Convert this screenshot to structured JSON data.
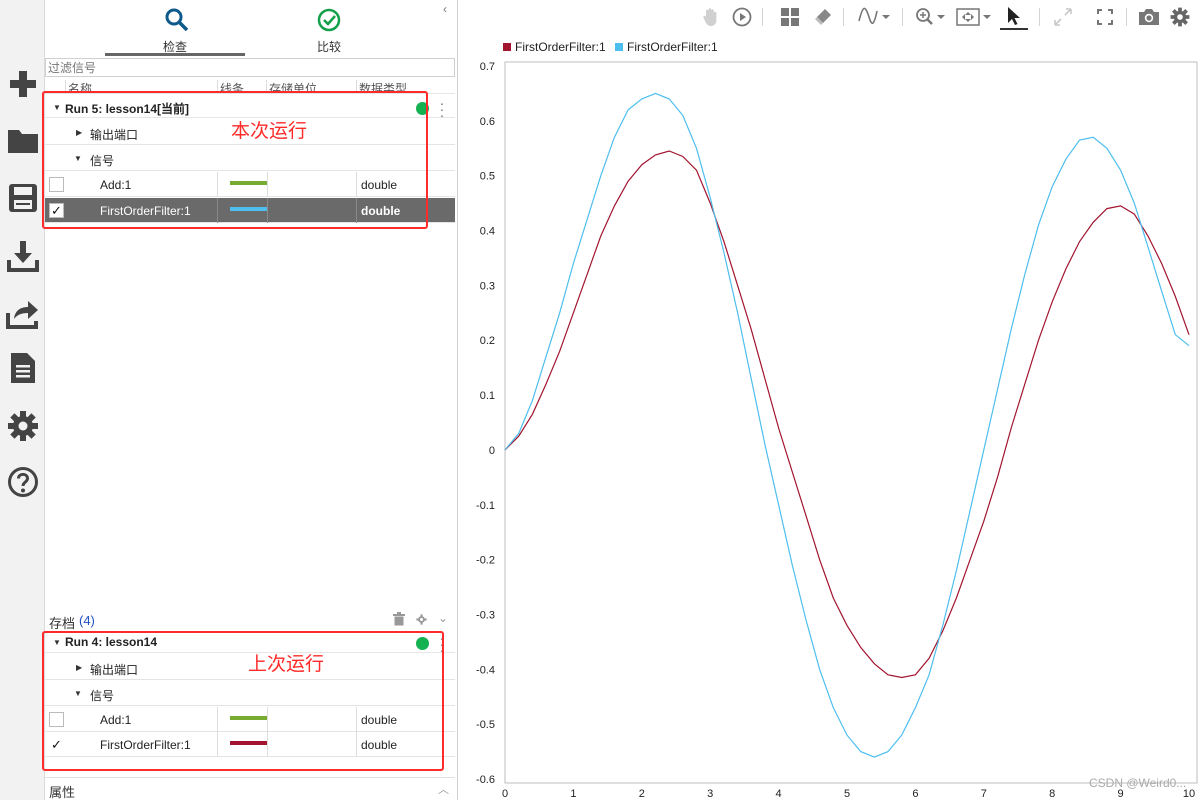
{
  "inspector": {
    "tabs": [
      {
        "label": "检查"
      },
      {
        "label": "比较"
      }
    ],
    "filter_placeholder": "过滤信号",
    "columns": [
      "名称",
      "线条",
      "存储单位",
      "数据类型"
    ],
    "current_run": {
      "title": "Run 5: lesson14[当前]",
      "groups": [
        {
          "label": "输出端口"
        },
        {
          "label": "信号"
        }
      ],
      "signals": [
        {
          "name": "Add:1",
          "line_color": "#77ac30",
          "type": "double",
          "checked": false
        },
        {
          "name": "FirstOrderFilter:1",
          "line_color": "#4dbeee",
          "type": "double",
          "checked": true
        }
      ],
      "annotation": "本次运行"
    },
    "archive": {
      "label": "存档",
      "count": "(4)",
      "run": {
        "title": "Run 4: lesson14",
        "groups": [
          {
            "label": "输出端口"
          },
          {
            "label": "信号"
          }
        ],
        "signals": [
          {
            "name": "Add:1",
            "line_color": "#77ac30",
            "type": "double",
            "checked": false
          },
          {
            "name": "FirstOrderFilter:1",
            "line_color": "#a2142f",
            "type": "double",
            "checked": true
          }
        ],
        "annotation": "上次运行"
      }
    },
    "properties_label": "属性",
    "check_mark": "✓"
  },
  "toolbar_icons": [
    "pan-icon",
    "play-icon",
    "layout-icon",
    "clear-icon",
    "signal-icon",
    "zoom-icon",
    "fit-icon",
    "cursor-icon",
    "expand-icon",
    "fullscreen-icon",
    "camera-icon",
    "settings-icon"
  ],
  "leftbar_icons": [
    "new-icon",
    "open-folder-icon",
    "save-icon",
    "download-icon",
    "share-icon",
    "report-icon",
    "settings-icon",
    "help-icon"
  ],
  "watermark": "CSDN @Weird0...",
  "chart_data": {
    "type": "line",
    "xlim": [
      0,
      10
    ],
    "ylim": [
      -0.6,
      0.7
    ],
    "x_ticks": [
      0,
      1,
      2,
      3,
      4,
      5,
      6,
      7,
      8,
      9,
      10
    ],
    "y_ticks": [
      0.7,
      0.6,
      0.5,
      0.4,
      0.3,
      0.2,
      0.1,
      0,
      -0.1,
      -0.2,
      -0.3,
      -0.4,
      -0.5,
      -0.6
    ],
    "grid": true,
    "legend_position": "top-left",
    "series": [
      {
        "name": "FirstOrderFilter:1",
        "color": "#a2142f",
        "x": [
          0,
          0.2,
          0.4,
          0.6,
          0.8,
          1.0,
          1.2,
          1.4,
          1.6,
          1.8,
          2.0,
          2.2,
          2.4,
          2.6,
          2.8,
          3.0,
          3.2,
          3.4,
          3.6,
          3.8,
          4.0,
          4.2,
          4.4,
          4.6,
          4.8,
          5.0,
          5.2,
          5.4,
          5.6,
          5.8,
          6.0,
          6.2,
          6.4,
          6.6,
          6.8,
          7.0,
          7.2,
          7.4,
          7.6,
          7.8,
          8.0,
          8.2,
          8.4,
          8.6,
          8.8,
          9.0,
          9.2,
          9.4,
          9.6,
          9.8,
          10.0
        ],
        "y": [
          0,
          0.025,
          0.065,
          0.12,
          0.18,
          0.25,
          0.32,
          0.39,
          0.445,
          0.49,
          0.52,
          0.538,
          0.545,
          0.535,
          0.51,
          0.45,
          0.38,
          0.3,
          0.22,
          0.13,
          0.04,
          -0.04,
          -0.12,
          -0.2,
          -0.27,
          -0.32,
          -0.36,
          -0.39,
          -0.41,
          -0.415,
          -0.41,
          -0.38,
          -0.33,
          -0.27,
          -0.2,
          -0.13,
          -0.05,
          0.04,
          0.12,
          0.2,
          0.27,
          0.33,
          0.38,
          0.415,
          0.44,
          0.445,
          0.43,
          0.39,
          0.34,
          0.28,
          0.21
        ]
      },
      {
        "name": "FirstOrderFilter:1",
        "color": "#4dbeee",
        "x": [
          0,
          0.2,
          0.4,
          0.6,
          0.8,
          1.0,
          1.2,
          1.4,
          1.6,
          1.8,
          2.0,
          2.2,
          2.4,
          2.6,
          2.8,
          3.0,
          3.2,
          3.4,
          3.6,
          3.8,
          4.0,
          4.2,
          4.4,
          4.6,
          4.8,
          5.0,
          5.2,
          5.4,
          5.6,
          5.8,
          6.0,
          6.2,
          6.4,
          6.6,
          6.8,
          7.0,
          7.2,
          7.4,
          7.6,
          7.8,
          8.0,
          8.2,
          8.4,
          8.6,
          8.8,
          9.0,
          9.2,
          9.4,
          9.6,
          9.8,
          10.0
        ],
        "y": [
          0,
          0.03,
          0.09,
          0.17,
          0.25,
          0.34,
          0.42,
          0.5,
          0.57,
          0.62,
          0.64,
          0.65,
          0.64,
          0.61,
          0.55,
          0.46,
          0.36,
          0.25,
          0.13,
          0.01,
          -0.1,
          -0.21,
          -0.31,
          -0.4,
          -0.47,
          -0.52,
          -0.55,
          -0.56,
          -0.55,
          -0.52,
          -0.47,
          -0.41,
          -0.32,
          -0.22,
          -0.11,
          0.0,
          0.11,
          0.22,
          0.32,
          0.41,
          0.48,
          0.53,
          0.565,
          0.57,
          0.55,
          0.51,
          0.45,
          0.37,
          0.29,
          0.21,
          0.19
        ]
      }
    ]
  }
}
